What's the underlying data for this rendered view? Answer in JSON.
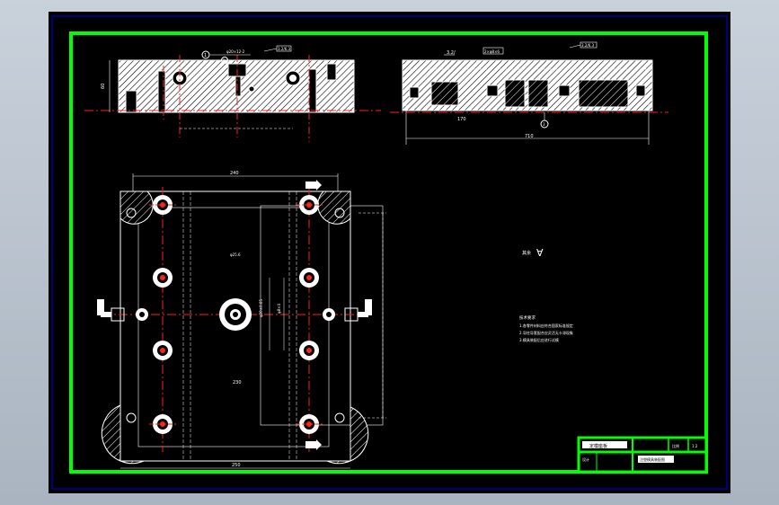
{
  "drawing": {
    "background": "#000000",
    "frame_color": "#00ff00",
    "border_color": "#0000a8",
    "center_line_color": "#ff2020",
    "line_color": "#ffffff",
    "top_view": {
      "callout_1": "1",
      "callout_2": "2",
      "note": "φ20×12-2",
      "tag_right": "3.2/6.3",
      "dim_height": "60"
    },
    "side_view": {
      "dim_top_left": "3.2/",
      "dim_top_mid": "2×φ8×6",
      "tag_right": "3.2/6.3",
      "dim_bottom_left": "170",
      "dim_bottom": "710",
      "callout": "3"
    },
    "plan_view": {
      "dim_top": "240",
      "dim_center": "φ25.6",
      "dim_inner": "230",
      "dim_bottom": "250",
      "dim_vertical_a": "φ20±0.05",
      "dim_vertical_b": "φ8×4"
    },
    "roughness": {
      "label": "其余",
      "symbol": "∀"
    },
    "notes": {
      "title": "技术要求",
      "lines": [
        "1.各零件材料应符合国家标准规定",
        "2.导柱导套配合应灵活无卡滞现象",
        "3.模具装配后应进行试模"
      ]
    },
    "title_block": {
      "row1": [
        "定模座板",
        "",
        "比例",
        "1:2"
      ],
      "row2": [
        "设计",
        "",
        "注塑模具装配图"
      ]
    }
  }
}
